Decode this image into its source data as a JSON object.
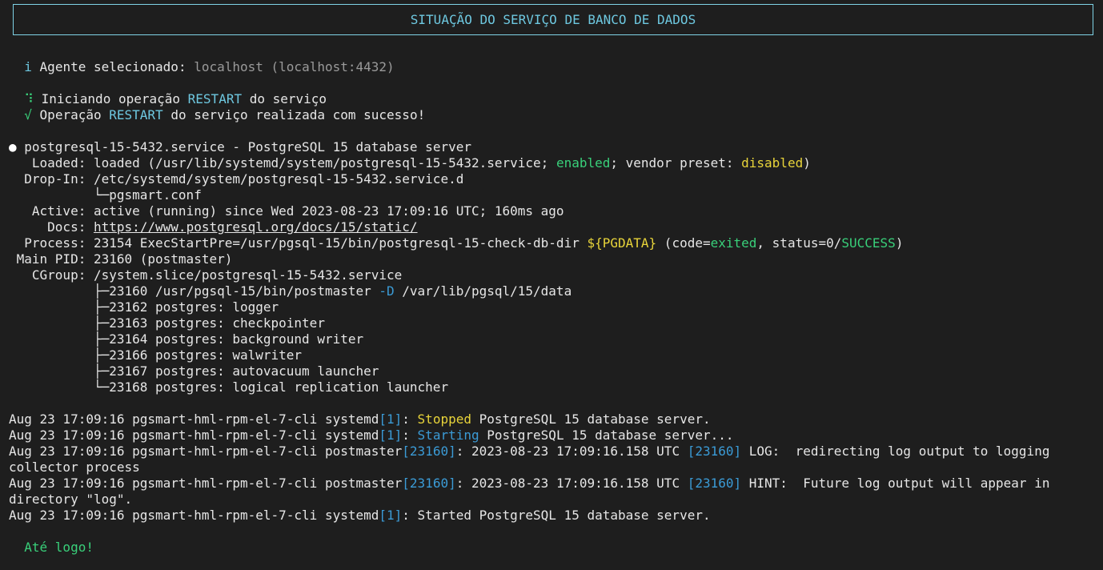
{
  "header": {
    "title": "SITUAÇÃO DO SERVIÇO DE BANCO DE DADOS"
  },
  "agent": {
    "icon": "i",
    "label": "Agente selecionado: ",
    "value": "localhost (localhost:4432)"
  },
  "operation": {
    "start_icon": "⠹",
    "start_pre": "Iniciando operação ",
    "start_keyword": "RESTART",
    "start_post": " do serviço",
    "done_icon": "√",
    "done_pre": "Operação ",
    "done_keyword": "RESTART",
    "done_post": " do serviço realizada com sucesso!"
  },
  "status": {
    "bullet": "●",
    "service_line": " postgresql-15-5432.service - PostgreSQL 15 database server",
    "loaded_pre": "   Loaded: loaded (/usr/lib/systemd/system/postgresql-15-5432.service; ",
    "loaded_enabled": "enabled",
    "loaded_mid": "; vendor preset: ",
    "loaded_disabled": "disabled",
    "loaded_post": ")",
    "dropin": "  Drop-In: /etc/systemd/system/postgresql-15-5432.service.d",
    "dropin_conf": "           └─pgsmart.conf",
    "active": "   Active: active (running) since Wed 2023-08-23 17:09:16 UTC; 160ms ago",
    "docs_pre": "     Docs: ",
    "docs_link": "https://www.postgresql.org/docs/15/static/",
    "process_pre": "  Process: 23154 ExecStartPre=/usr/pgsql-15/bin/postgresql-15-check-db-dir ",
    "process_var": "${PGDATA}",
    "process_mid1": " (code=",
    "process_exited": "exited",
    "process_mid2": ", status=0/",
    "process_success": "SUCCESS",
    "process_post": ")",
    "main_pid": " Main PID: 23160 (postmaster)",
    "cgroup": "   CGroup: /system.slice/postgresql-15-5432.service",
    "tree_postmaster_pre": "           ├─23160 /usr/pgsql-15/bin/postmaster ",
    "tree_postmaster_flag": "-D",
    "tree_postmaster_post": " /var/lib/pgsql/15/data",
    "tree_items": [
      "           ├─23162 postgres: logger",
      "           ├─23163 postgres: checkpointer",
      "           ├─23164 postgres: background writer",
      "           ├─23166 postgres: walwriter",
      "           ├─23167 postgres: autovacuum launcher",
      "           └─23168 postgres: logical replication launcher"
    ]
  },
  "logs": {
    "l1_pre": "Aug 23 17:09:16 pgsmart-hml-rpm-el-7-cli systemd",
    "l1_pid": "[1]",
    "l1_colon": ": ",
    "l1_kw": "Stopped",
    "l1_post": " PostgreSQL 15 database server.",
    "l2_pre": "Aug 23 17:09:16 pgsmart-hml-rpm-el-7-cli systemd",
    "l2_pid": "[1]",
    "l2_colon": ": ",
    "l2_kw": "Starting",
    "l2_post": " PostgreSQL 15 database server...",
    "l3_pre": "Aug 23 17:09:16 pgsmart-hml-rpm-el-7-cli postmaster",
    "l3_pid": "[23160]",
    "l3_mid": ": 2023-08-23 17:09:16.158 UTC ",
    "l3_pid2": "[23160]",
    "l3_post": " LOG:  redirecting log output to logging",
    "l3_wrap": "collector process",
    "l4_pre": "Aug 23 17:09:16 pgsmart-hml-rpm-el-7-cli postmaster",
    "l4_pid": "[23160]",
    "l4_mid": ": 2023-08-23 17:09:16.158 UTC ",
    "l4_pid2": "[23160]",
    "l4_post": " HINT:  Future log output will appear in",
    "l4_wrap": "directory \"log\".",
    "l5_pre": "Aug 23 17:09:16 pgsmart-hml-rpm-el-7-cli systemd",
    "l5_pid": "[1]",
    "l5_post": ": Started PostgreSQL 15 database server."
  },
  "footer": {
    "goodbye": "Até logo!"
  },
  "colors": {
    "background": "#1e1e1e",
    "foreground": "#e6e6e6",
    "cyan": "#6ec8e0",
    "blue": "#3b9bd6",
    "green": "#39d07a",
    "yellow": "#e8d43a",
    "gray": "#9a9a9a"
  }
}
